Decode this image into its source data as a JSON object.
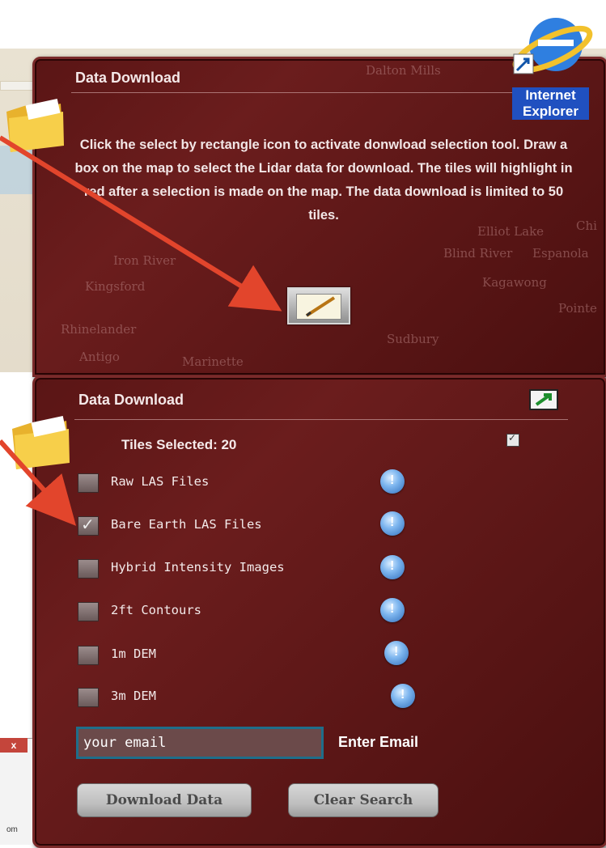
{
  "top_panel": {
    "title": "Data Download",
    "instructions": "Click the select by rectangle icon to activate donwload selection tool.  Draw a box on the map to select the Lidar data for download.  The tiles will highlight in red after a selection is made on the map.  The data download is limited to 50 tiles.",
    "map_labels": [
      "Dalton Mills",
      "Iron River",
      "Kingsford",
      "Rhinelander",
      "Antigo",
      "Marinette",
      "Elliot Lake",
      "Blind River",
      "Espanola",
      "Kagawong",
      "Pointe",
      "Sudbury",
      "Chi"
    ]
  },
  "desktop_icon": {
    "name": "ie-icon",
    "label_line1": "Internet",
    "label_line2": "Explorer"
  },
  "bottom_panel": {
    "title": "Data Download",
    "tiles_selected": "Tiles Selected: 20",
    "options": [
      {
        "label": "Raw LAS Files",
        "checked": false
      },
      {
        "label": "Bare Earth LAS Files",
        "checked": true
      },
      {
        "label": "Hybrid Intensity Images",
        "checked": false
      },
      {
        "label": "2ft Contours",
        "checked": false
      },
      {
        "label": "1m DEM",
        "checked": false
      },
      {
        "label": "3m DEM",
        "checked": false
      }
    ],
    "email_value": "your email",
    "email_label": "Enter Email",
    "download_button": "Download Data",
    "clear_button": "Clear Search"
  },
  "window_fragment": {
    "close_label": "x",
    "zoom_text": "om"
  },
  "colors": {
    "panel_bg": "#5a1515",
    "arrow": "#e2452c",
    "email_border": "#1f6e8a"
  }
}
